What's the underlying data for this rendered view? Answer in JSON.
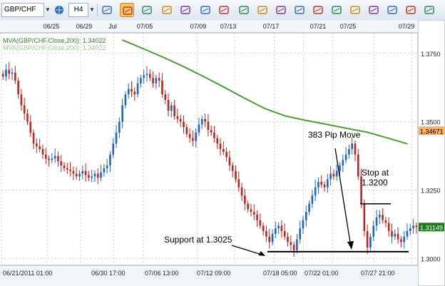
{
  "toolbar": {
    "symbol": "GBP/CHF",
    "period": "H4",
    "buttons": [
      "chart-type-icon",
      "chart-type-icon",
      "bar-chart-icon",
      "candlestick-icon",
      "indicator-icon",
      "crosshair-icon",
      "zoom-in-icon",
      "zoom-out-icon",
      "draw-tools-icon",
      "text-icon",
      "save-icon",
      "color-icon",
      "ruler-icon",
      "image-icon",
      "more-icon",
      "settings-icon",
      "layout-icon",
      "line-icon"
    ]
  },
  "chart_data": {
    "type": "candlestick",
    "symbol": "GBP/CHF",
    "timeframe": "H4",
    "ylim": [
      1.2975,
      1.3825
    ],
    "yticks": [
      1.375,
      1.35,
      1.325,
      1.3
    ],
    "ytick_labels": [
      "1.3750",
      "1.3500",
      "1.3250",
      "1.3000"
    ],
    "top_axis_labels": [
      "06/25",
      "06/29",
      "Jul",
      "07/05",
      "07/09",
      "07/13",
      "07/17",
      "07/21",
      "07/25",
      "07/29"
    ],
    "bottom_axis_labels": [
      "06/21/2011 01:00",
      "06/30 17:00",
      "07/06 13:00",
      "07/12 09:00",
      "07/18 05:00",
      "07/22 01:00",
      "07/27 21:00"
    ],
    "legend": [
      {
        "text": "MVA(GBP/CHF.Close,200): 1.34022",
        "color": "#3a7a2c"
      },
      {
        "text": "MVA(GBP/CHF.Close,200): 1.34022",
        "color": "#9cc78c"
      }
    ],
    "price_tags": [
      {
        "text": "1.34671",
        "value": 1.34671,
        "bg": "#f6b26b",
        "fg": "#000000"
      },
      {
        "text": "1.31149",
        "value": 1.31149,
        "bg": "#1e7a1e",
        "fg": "#ffffff"
      }
    ],
    "colors": {
      "up": "#1f63c6",
      "down": "#c0231e",
      "mva": "#4f9a38",
      "grid": "#c9cfd6"
    },
    "mva": [
      [
        0,
        1.3799
      ],
      [
        10,
        1.3768
      ],
      [
        20,
        1.3736
      ],
      [
        30,
        1.3702
      ],
      [
        40,
        1.3665
      ],
      [
        50,
        1.3626
      ],
      [
        60,
        1.3586
      ],
      [
        70,
        1.3548
      ],
      [
        80,
        1.3521
      ],
      [
        90,
        1.3505
      ],
      [
        100,
        1.3491
      ],
      [
        110,
        1.3476
      ],
      [
        120,
        1.3462
      ],
      [
        130,
        1.3441
      ],
      [
        140,
        1.3419
      ]
    ],
    "closes": [
      1.3665,
      1.369,
      1.3675,
      1.368,
      1.365,
      1.36,
      1.356,
      1.353,
      1.35,
      1.346,
      1.342,
      1.341,
      1.34,
      1.338,
      1.3365,
      1.336,
      1.3365,
      1.3375,
      1.3355,
      1.334,
      1.333,
      1.3325,
      1.332,
      1.331,
      1.33,
      1.331,
      1.332,
      1.3305,
      1.3295,
      1.33,
      1.331,
      1.3295,
      1.3315,
      1.333,
      1.334,
      1.338,
      1.342,
      1.346,
      1.35,
      1.356,
      1.36,
      1.362,
      1.361,
      1.36,
      1.364,
      1.366,
      1.367,
      1.3675,
      1.366,
      1.364,
      1.366,
      1.365,
      1.36,
      1.358,
      1.354,
      1.356,
      1.352,
      1.351,
      1.35,
      1.348,
      1.3455,
      1.344,
      1.343,
      1.346,
      1.349,
      1.351,
      1.35,
      1.347,
      1.346,
      1.344,
      1.342,
      1.34,
      1.339,
      1.337,
      1.334,
      1.332,
      1.329,
      1.326,
      1.323,
      1.32,
      1.318,
      1.317,
      1.316,
      1.314,
      1.312,
      1.31,
      1.308,
      1.306,
      1.309,
      1.311,
      1.312,
      1.31,
      1.308,
      1.306,
      1.305,
      1.303,
      1.307,
      1.311,
      1.314,
      1.317,
      1.32,
      1.323,
      1.326,
      1.328,
      1.327,
      1.326,
      1.329,
      1.331,
      1.33,
      1.332,
      1.334,
      1.336,
      1.338,
      1.34,
      1.342,
      1.338,
      1.33,
      1.32,
      1.31,
      1.304,
      1.308,
      1.312,
      1.315,
      1.316,
      1.314,
      1.313,
      1.31,
      1.308,
      1.309,
      1.307,
      1.306,
      1.308,
      1.31,
      1.311,
      1.312,
      1.3115
    ],
    "annotations": [
      {
        "text": "383 Pip Move"
      },
      {
        "text": "Stop at"
      },
      {
        "text": "1.3200"
      },
      {
        "text": "Support at 1.3025"
      }
    ],
    "support_level": 1.3025,
    "stop_level": 1.32
  }
}
